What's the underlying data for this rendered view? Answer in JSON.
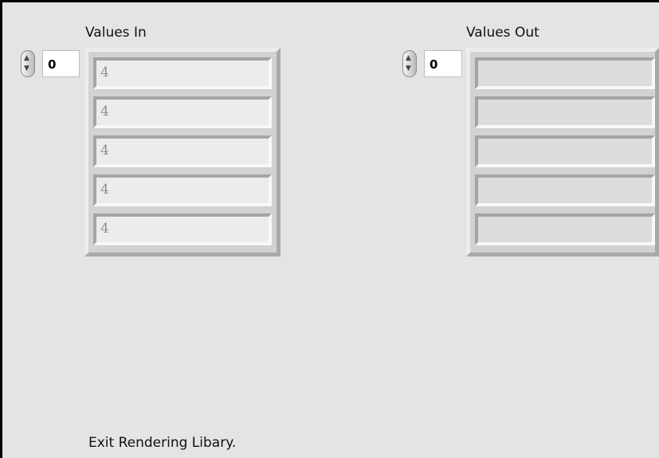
{
  "values_in": {
    "title": "Values In",
    "index": "0",
    "items": [
      "4",
      "4",
      "4",
      "4",
      "4"
    ]
  },
  "values_out": {
    "title": "Values Out",
    "index": "0",
    "items": [
      "",
      "",
      "",
      "",
      ""
    ]
  },
  "status_text": "Exit Rendering Libary."
}
